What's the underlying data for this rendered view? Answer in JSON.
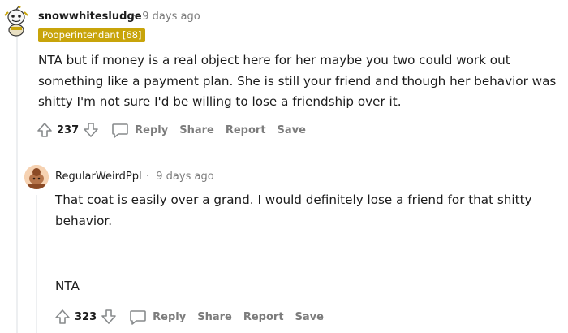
{
  "comments": [
    {
      "username": "snowwhitesludge",
      "time": "9 days ago",
      "flair": "Pooperintendant [68]",
      "body": "NTA but if money is a real object here for her maybe you two could work out something like a payment plan. She is still your friend and though her behavior was shitty I'm not sure I'd be willing to lose a friendship over it.",
      "score": "237",
      "actions": {
        "reply": "Reply",
        "share": "Share",
        "report": "Report",
        "save": "Save"
      }
    },
    {
      "username": "RegularWeirdPpl",
      "time": "9 days ago",
      "body_paragraph_1": "That coat is easily over a grand. I would definitely lose a friend for that shitty behavior.",
      "body_paragraph_2": "NTA",
      "score": "323",
      "actions": {
        "reply": "Reply",
        "share": "Share",
        "report": "Report",
        "save": "Save"
      }
    }
  ],
  "meta_separator": "·",
  "colors": {
    "flair_bg": "#c8a40a",
    "meta_gray": "#7c7c7c",
    "text": "#1c1c1c",
    "thread_line": "#edeff1"
  },
  "icons": [
    "snoo-avatar",
    "snoo-avatar-orange",
    "upvote-icon",
    "downvote-icon",
    "comment-icon"
  ]
}
